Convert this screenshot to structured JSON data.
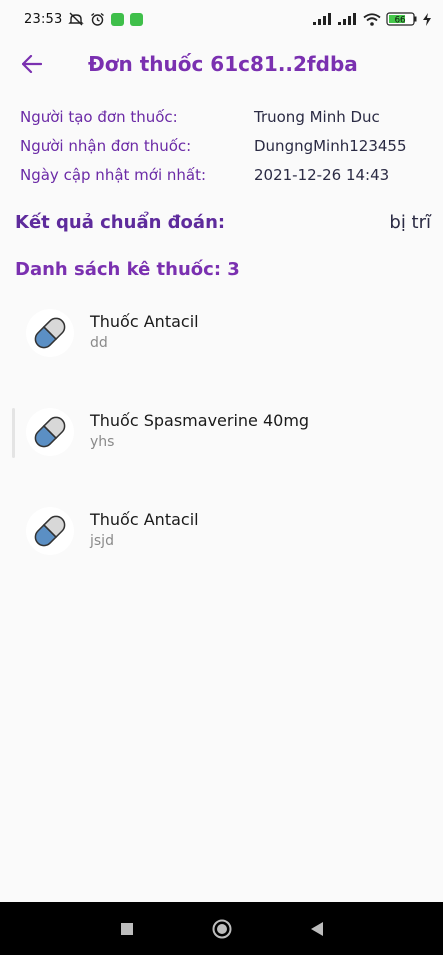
{
  "status_bar": {
    "time": "23:53",
    "battery": "66"
  },
  "app_bar": {
    "title": "Đơn thuốc 61c81..2fdba"
  },
  "info": [
    {
      "label": "Người tạo đơn thuốc:",
      "value": "Truong Minh Duc"
    },
    {
      "label": "Người nhận đơn thuốc:",
      "value": "DungngMinh123455"
    },
    {
      "label": "Ngày cập nhật mới nhất:",
      "value": "2021-12-26 14:43"
    }
  ],
  "diagnosis": {
    "label": "Kết quả chuẩn đoán:",
    "value": "bị trĩ"
  },
  "medicine_list": {
    "title": "Danh sách kê thuốc: 3",
    "items": [
      {
        "name": "Thuốc Antacil",
        "note": "dd",
        "icon": "pill-icon"
      },
      {
        "name": "Thuốc Spasmaverine 40mg",
        "note": "yhs",
        "icon": "pill-icon"
      },
      {
        "name": "Thuốc Antacil",
        "note": "jsjd",
        "icon": "pill-icon"
      }
    ]
  },
  "colors": {
    "accent": "#7a30b0",
    "label": "#6b2aa6",
    "value": "#2b2b44"
  }
}
